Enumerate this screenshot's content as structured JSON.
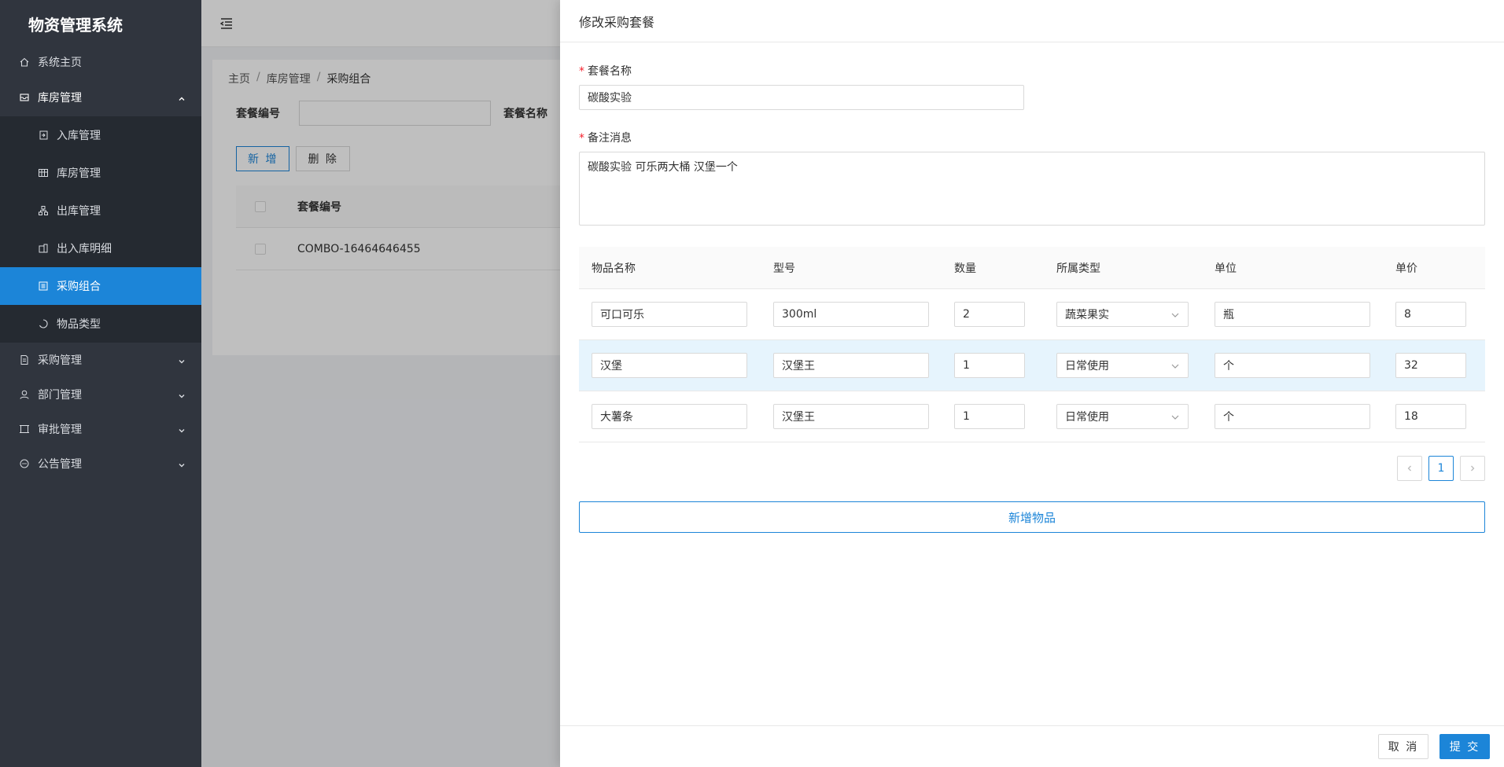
{
  "app": {
    "title": "物资管理系统"
  },
  "sidebar": {
    "home": "系统主页",
    "warehouse": {
      "label": "库房管理",
      "items": [
        "入库管理",
        "库房管理",
        "出库管理",
        "出入库明细",
        "采购组合",
        "物品类型"
      ]
    },
    "purchase": "采购管理",
    "department": "部门管理",
    "approval": "审批管理",
    "notice": "公告管理"
  },
  "content": {
    "breadcrumb": [
      "主页",
      "库房管理",
      "采购组合"
    ],
    "search": {
      "code_label": "套餐编号",
      "name_label": "套餐名称"
    },
    "buttons": {
      "add": "新 增",
      "delete": "删 除"
    },
    "table": {
      "header_code": "套餐编号",
      "rows": [
        {
          "code": "COMBO-16464646455"
        }
      ]
    }
  },
  "drawer": {
    "title": "修改采购套餐",
    "name_label": "套餐名称",
    "name_value": "碳酸实验",
    "remark_label": "备注消息",
    "remark_value": "碳酸实验 可乐两大桶 汉堡一个",
    "table": {
      "headers": [
        "物品名称",
        "型号",
        "数量",
        "所属类型",
        "单位",
        "单价"
      ],
      "rows": [
        {
          "name": "可口可乐",
          "model": "300ml",
          "qty": "2",
          "type": "蔬菜果实",
          "unit": "瓶",
          "price": "8"
        },
        {
          "name": "汉堡",
          "model": "汉堡王",
          "qty": "1",
          "type": "日常使用",
          "unit": "个",
          "price": "32"
        },
        {
          "name": "大薯条",
          "model": "汉堡王",
          "qty": "1",
          "type": "日常使用",
          "unit": "个",
          "price": "18"
        }
      ]
    },
    "pagination": {
      "current": "1"
    },
    "add_item_label": "新增物品",
    "cancel_label": "取 消",
    "submit_label": "提 交"
  },
  "colors": {
    "sidebar_bg": "#30353e",
    "accent": "#1c85d8",
    "required": "#f5222d"
  }
}
